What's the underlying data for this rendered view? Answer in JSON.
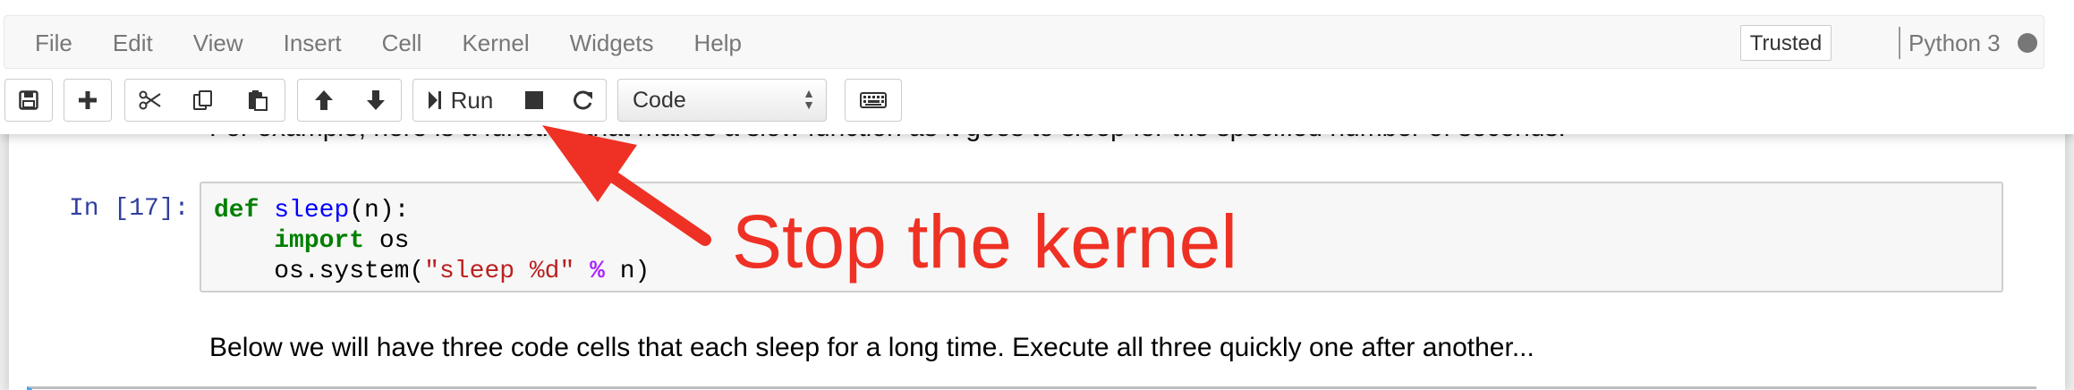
{
  "menu": {
    "items": [
      "File",
      "Edit",
      "View",
      "Insert",
      "Cell",
      "Kernel",
      "Widgets",
      "Help"
    ],
    "trusted_label": "Trusted",
    "kernel_name": "Python 3"
  },
  "toolbar": {
    "buttons": [
      {
        "name": "save-icon"
      },
      {
        "name": "insert-cell-icon"
      },
      {
        "name": "cut-icon"
      },
      {
        "name": "copy-icon"
      },
      {
        "name": "paste-icon"
      },
      {
        "name": "move-up-icon"
      },
      {
        "name": "move-down-icon"
      },
      {
        "name": "run-icon"
      },
      {
        "name": "stop-icon"
      },
      {
        "name": "restart-icon"
      },
      {
        "name": "keyboard-icon"
      }
    ],
    "run_label": "Run",
    "cell_type": "Code"
  },
  "notebook": {
    "md_top": "For example, here is a function that makes a slow function as it goes to sleep for the specified number of seconds.",
    "prompt": "In [17]:",
    "code": {
      "line1_kw": "def",
      "line1_fn": "sleep",
      "line1_rest": "(n):",
      "line2_kw": "import",
      "line2_rest": " os",
      "line3_pre": "    os.system(",
      "line3_str": "\"sleep %d\"",
      "line3_op": "%",
      "line3_post": " n)"
    },
    "md_bottom": "Below we will have three code cells that each sleep for a long time. Execute all three quickly one after another..."
  },
  "annotation": {
    "text": "Stop the kernel",
    "color": "#ee3124"
  }
}
